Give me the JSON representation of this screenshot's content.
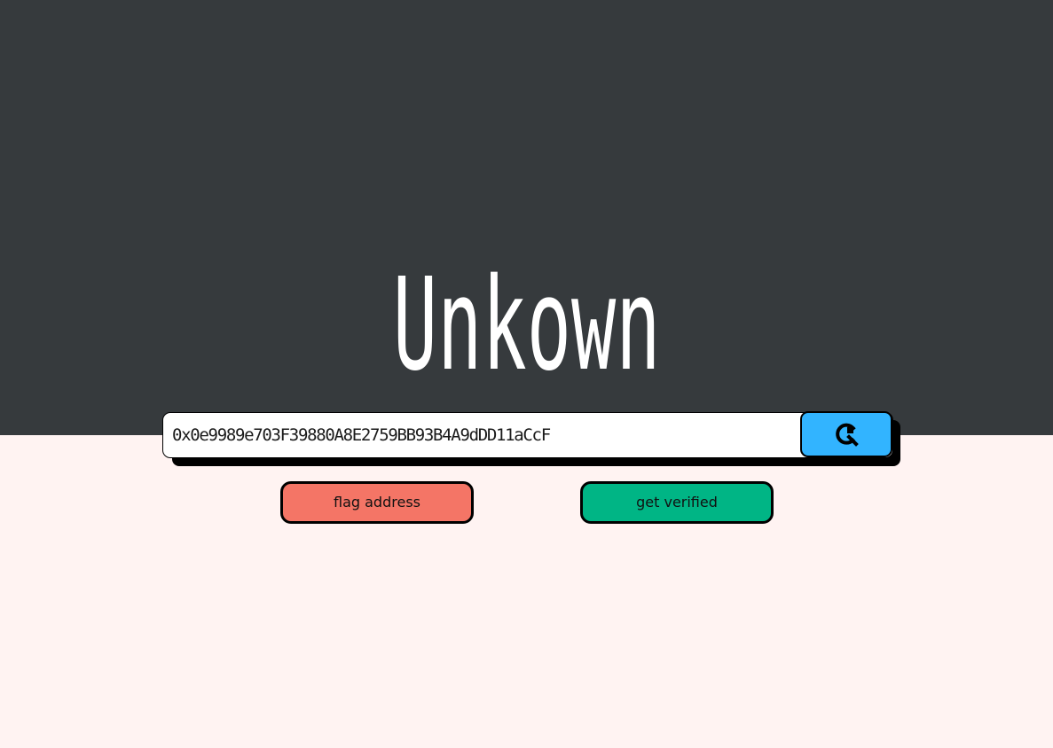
{
  "page": {
    "status_title": "Unkown"
  },
  "search": {
    "address_value": "0x0e9989e703F39880A8E2759BB93B4A9dDD11aCcF",
    "button_icon": "search-refresh-icon"
  },
  "actions": {
    "flag_label": "flag address",
    "verify_label": "get verified"
  },
  "colors": {
    "header_background": "#363a3d",
    "page_background": "#fff3f2",
    "search_button": "#32b4ff",
    "flag_button": "#f47566",
    "verify_button": "#00b585"
  }
}
